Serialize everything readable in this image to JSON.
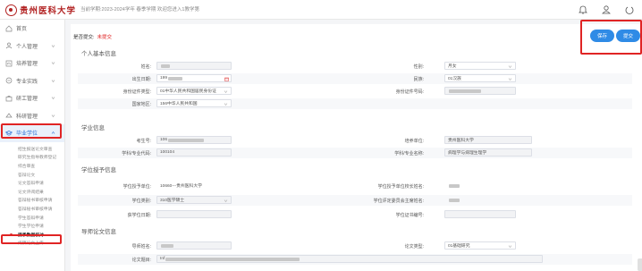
{
  "header": {
    "logo_text": "贵州医科大学",
    "term_text": "当前学期:2023-2024学年 春季学期  欢迎您进入1教学第",
    "icons": [
      "bell-icon",
      "user-icon",
      "power-icon"
    ]
  },
  "sidebar": {
    "items": [
      {
        "label": "首页",
        "icon": "home-icon"
      },
      {
        "label": "个人管理",
        "icon": "person-icon"
      },
      {
        "label": "培养管理",
        "icon": "chart-icon"
      },
      {
        "label": "专业实践",
        "icon": "flask-icon"
      },
      {
        "label": "研工管理",
        "icon": "briefcase-icon"
      },
      {
        "label": "科研管理",
        "icon": "research-icon"
      },
      {
        "label": "毕业学位",
        "icon": "graduation-icon"
      }
    ],
    "sub_items": [
      "招生报送论文审查",
      "研究生指导教师登记",
      "综合审查",
      "答辩论文",
      "论文答辩申请",
      "论文评阅结果",
      "答辩秘书审核申请",
      "答辩秘书审核申请",
      "学生答辩申请",
      "学生学位申请",
      "授予数据核对",
      "终稿论文上传"
    ],
    "current_sub": "授予数据核对"
  },
  "main": {
    "status_label": "是否提交:",
    "status_value": "未提交",
    "save_button": "保存",
    "submit_button": "提交",
    "sections": {
      "personal": "个人基本信息",
      "education": "学业信息",
      "degree": "学位授予信息",
      "thesis": "导师论文信息"
    },
    "personal": {
      "name_label": "姓名:",
      "name_value": "",
      "gender_label": "性别:",
      "gender_value": "月女",
      "birth_label": "出生日期:",
      "birth_value": "199",
      "ethnic_label": "民族:",
      "ethnic_value": "01汉族",
      "id_type_label": "身份证件类型:",
      "id_type_value": "01中华人民共和国居民身份证",
      "id_no_label": "身份证件号码:",
      "id_no_value": "",
      "country_label": "国家地区:",
      "country_value": "156中华人民共和国"
    },
    "education": {
      "student_no_label": "考生号:",
      "student_no_value": "106",
      "train_unit_label": "培养单位:",
      "train_unit_value": "贵州医科大学",
      "major_code_label": "学科/专业代码:",
      "major_code_value": "100104",
      "major_name_label": "学科/专业名称:",
      "major_name_value": "病理学与病理生理学"
    },
    "degree": {
      "unit_label": "学位授予单位:",
      "unit_value": "10660---贵州医科大学",
      "unit_leader_label": "学位授予单位校长姓名:",
      "unit_leader_value": "",
      "category_label": "学位类别:",
      "category_value": "310医学硕士",
      "committee_label": "学位评定委员会主席姓名:",
      "committee_value": "",
      "date_label": "获学位日期:",
      "date_value": "",
      "cert_label": "学位证书编号:",
      "cert_value": ""
    },
    "thesis": {
      "advisor_label": "导师姓名:",
      "advisor_value": "",
      "type_label": "论文类型:",
      "type_value": "01基础研究",
      "title_label": "论文题目:",
      "title_value": "Inf"
    }
  },
  "colors": {
    "accent": "#2f8be6",
    "highlight": "#e02424",
    "logo": "#b22222"
  }
}
